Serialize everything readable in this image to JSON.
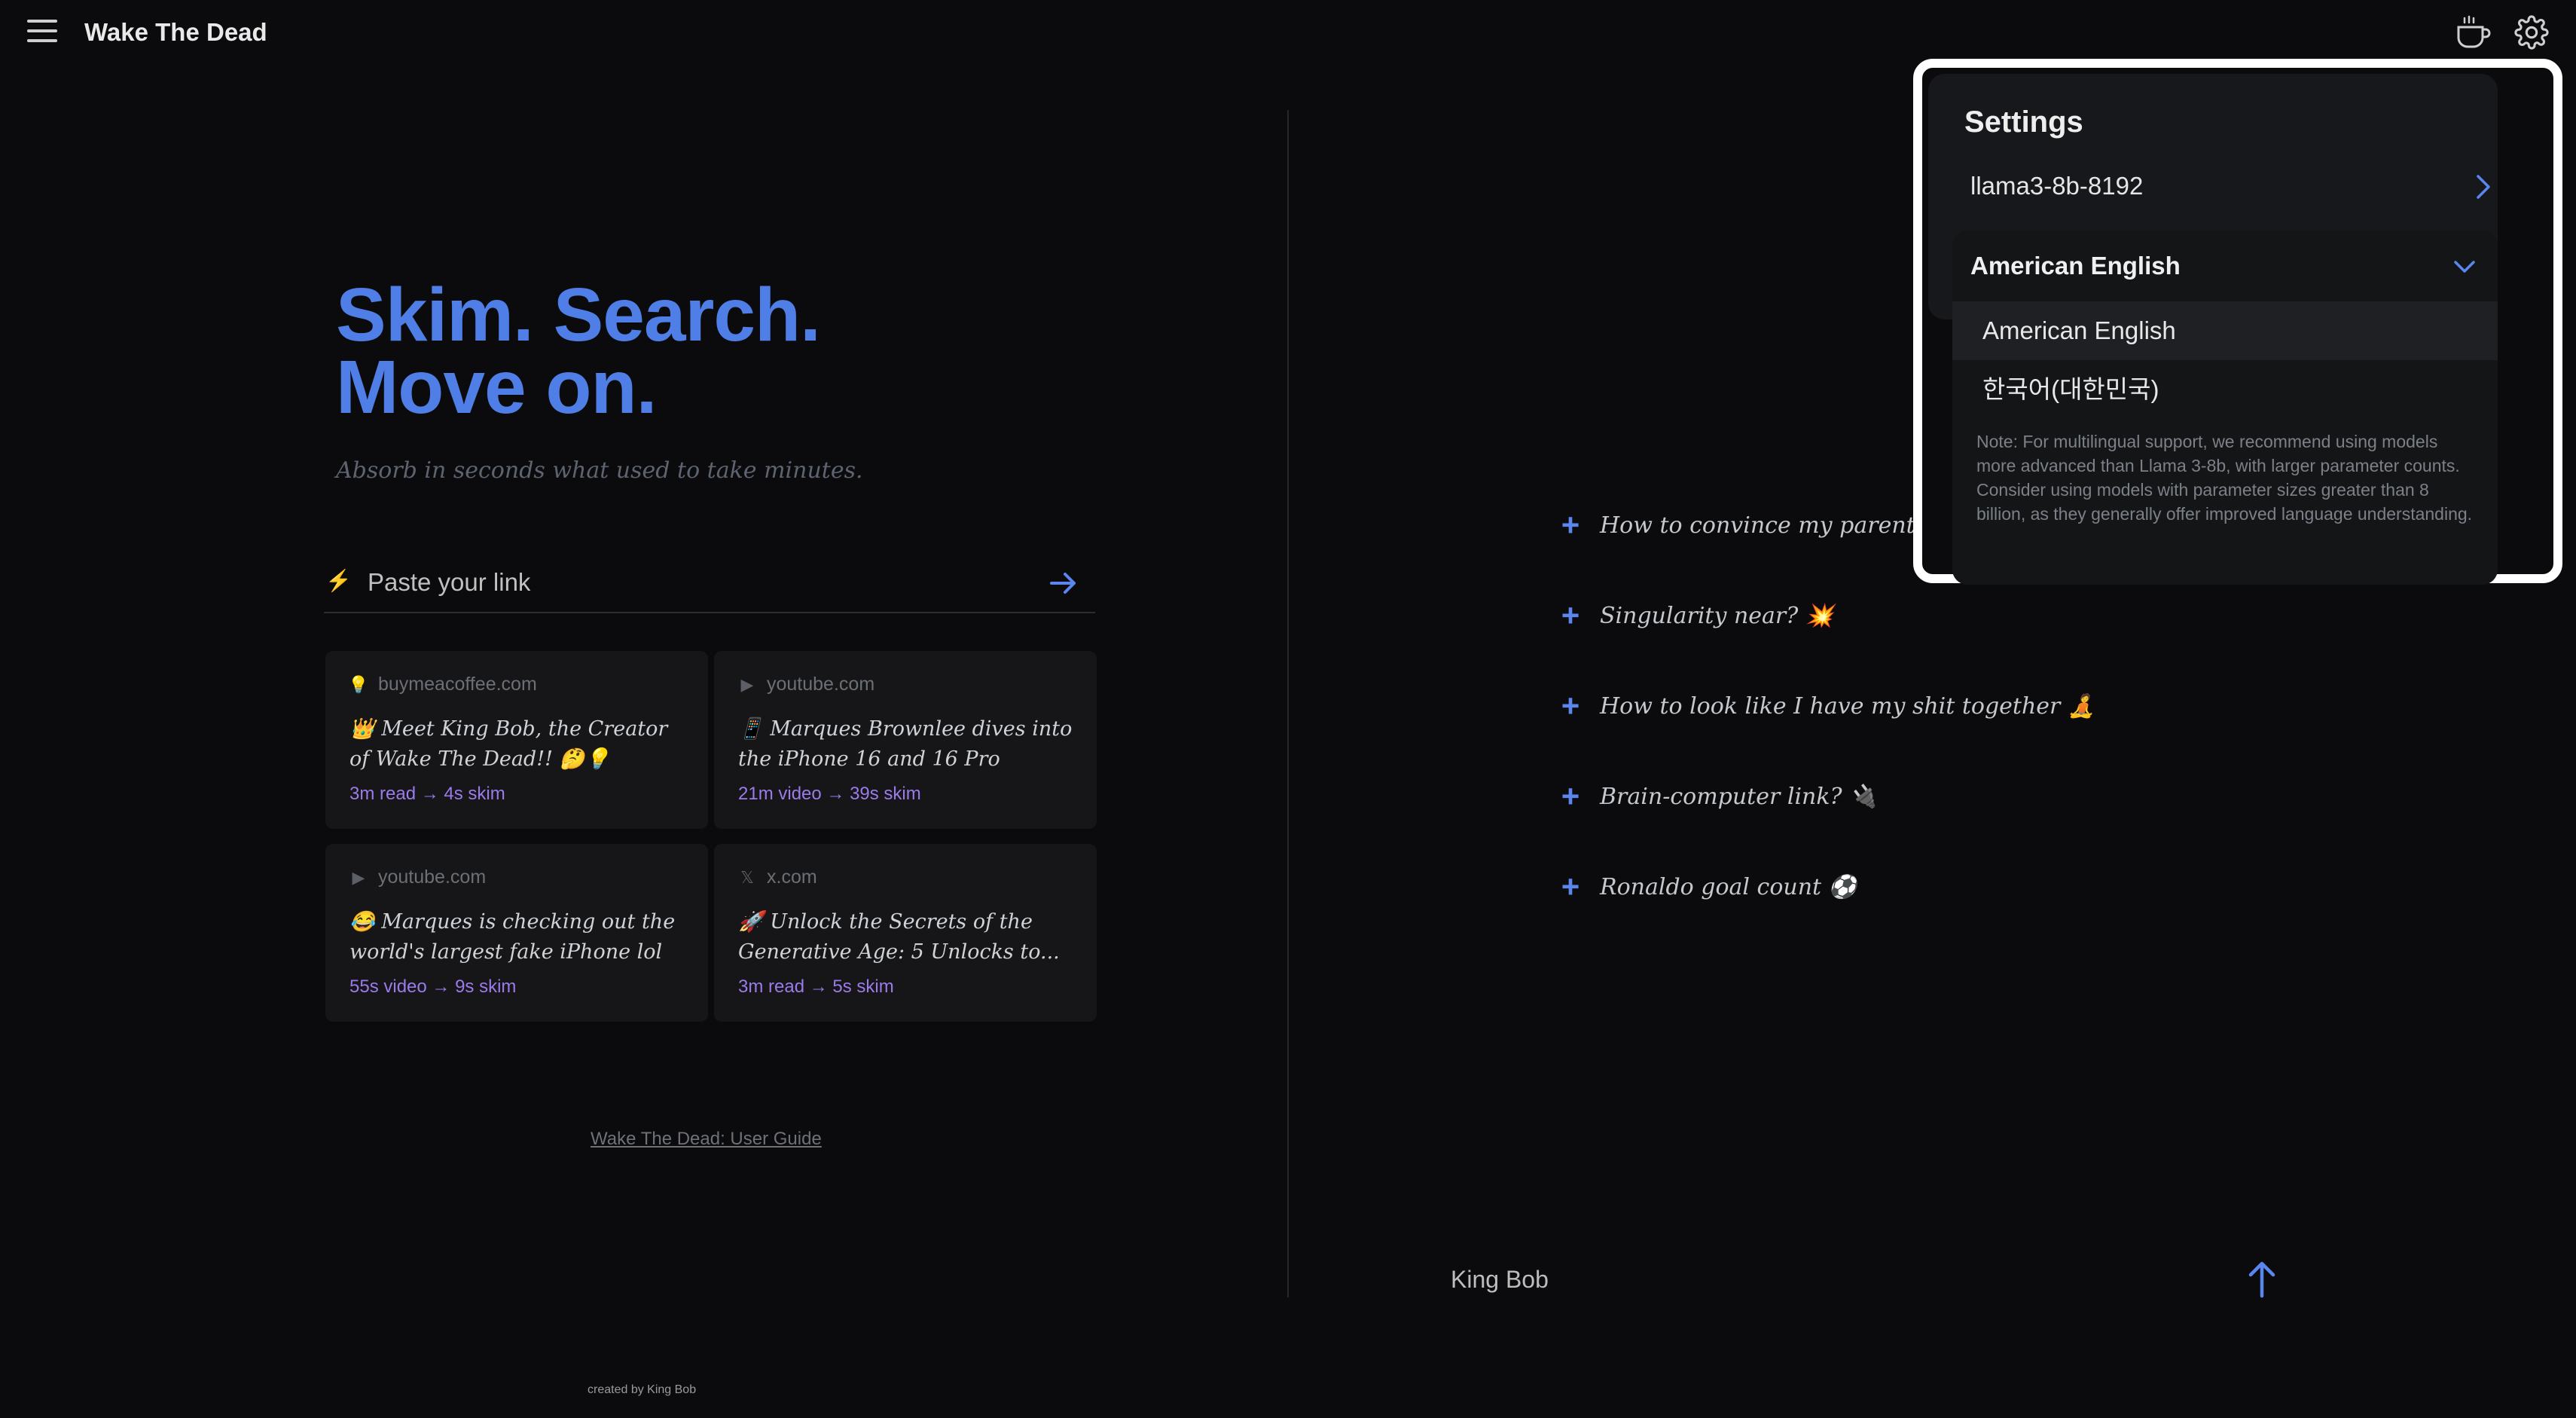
{
  "header": {
    "title": "Wake The Dead",
    "menu_icon": "hamburger-menu-icon",
    "coffee_icon": "coffee-cup-icon",
    "settings_icon": "gear-icon"
  },
  "hero": {
    "title_line1": "Skim. Search.",
    "title_line2": "Move on.",
    "subtitle": "Absorb in seconds what used to take minutes."
  },
  "link_input": {
    "placeholder": "Paste your link",
    "bolt_glyph": "⚡"
  },
  "cards": [
    {
      "source": "buymeacoffee.com",
      "source_glyph": "💡",
      "title": "👑 Meet King Bob, the Creator of Wake The Dead!! 🤔💡",
      "meta": "3m read → 4s skim"
    },
    {
      "source": "youtube.com",
      "source_glyph": "▶",
      "title": "📱 Marques Brownlee dives into the iPhone 16 and 16 Pro",
      "meta": "21m video → 39s skim"
    },
    {
      "source": "youtube.com",
      "source_glyph": "▶",
      "title": "😂 Marques is checking out the world's largest fake iPhone lol",
      "meta": "55s video → 9s skim"
    },
    {
      "source": "x.com",
      "source_glyph": "𝕏",
      "title": "🚀 Unlock the Secrets of the Generative Age: 5 Unlocks to...",
      "meta": "3m read → 5s skim"
    }
  ],
  "guide_link": "Wake The Dead: User Guide",
  "created_by": "created by King Bob",
  "suggestions": [
    {
      "plus": "+",
      "text": "How to convince my parents I'm i"
    },
    {
      "plus": "+",
      "text": "Singularity near? 💥"
    },
    {
      "plus": "+",
      "text": "How to look like I have my shit together 🧘"
    },
    {
      "plus": "+",
      "text": "Brain-computer link? 🔌"
    },
    {
      "plus": "+",
      "text": "Ronaldo goal count ⚽"
    }
  ],
  "user": {
    "name": "King Bob"
  },
  "settings": {
    "title": "Settings",
    "model": "llama3-8b-8192",
    "language_selected": "American English",
    "language_options": [
      "American English",
      "한국어(대한민국)"
    ],
    "note": "Note: For multilingual support, we recommend using models more advanced than Llama 3-8b, with larger parameter counts. Consider using models with parameter sizes greater than 8 billion, as they generally offer improved language understanding."
  },
  "colors": {
    "background": "#0b0b0d",
    "accent_blue": "#4f7fe6",
    "meta_purple": "#9b7bea"
  }
}
